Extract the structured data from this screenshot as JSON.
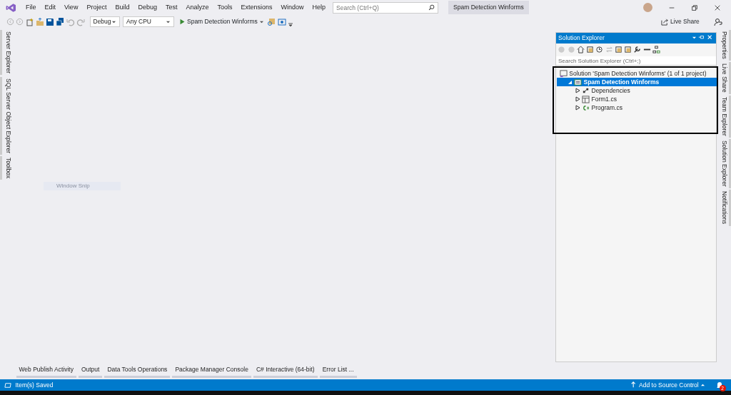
{
  "menu": [
    "File",
    "Edit",
    "View",
    "Project",
    "Build",
    "Debug",
    "Test",
    "Analyze",
    "Tools",
    "Extensions",
    "Window",
    "Help"
  ],
  "search": {
    "placeholder": "Search (Ctrl+Q)"
  },
  "window_title": "Spam Detection Winforms",
  "toolbar": {
    "configuration": "Debug",
    "platform": "Any CPU",
    "start": "Spam Detection Winforms"
  },
  "live_share": "Live Share",
  "left_tabs": [
    "Server Explorer",
    "SQL Server Object Explorer",
    "Toolbox"
  ],
  "right_tabs": [
    "Properties",
    "Live Share",
    "Team Explorer",
    "Solution Explorer",
    "Notifications"
  ],
  "snip_tooltip": "Window Snip",
  "solution_explorer": {
    "title": "Solution Explorer",
    "search": {
      "placeholder": "Search Solution Explorer (Ctrl+;)"
    },
    "tree": [
      {
        "label": "Solution 'Spam Detection Winforms' (1 of 1 project)",
        "kind": "solution",
        "selected": false,
        "children": [
          {
            "label": "Spam Detection Winforms",
            "kind": "project",
            "selected": true,
            "expanded": true,
            "children": [
              {
                "label": "Dependencies",
                "kind": "dependencies",
                "selected": false,
                "expanded": false
              },
              {
                "label": "Form1.cs",
                "kind": "form",
                "selected": false,
                "expanded": false
              },
              {
                "label": "Program.cs",
                "kind": "csharp",
                "selected": false,
                "expanded": false
              }
            ]
          }
        ]
      }
    ]
  },
  "bottom_tabs": [
    "Web Publish Activity",
    "Output",
    "Data Tools Operations",
    "Package Manager Console",
    "C# Interactive (64-bit)",
    "Error List ..."
  ],
  "status_bar": {
    "message": "Item(s) Saved",
    "source_control": "Add to Source Control",
    "notifications": "2"
  }
}
